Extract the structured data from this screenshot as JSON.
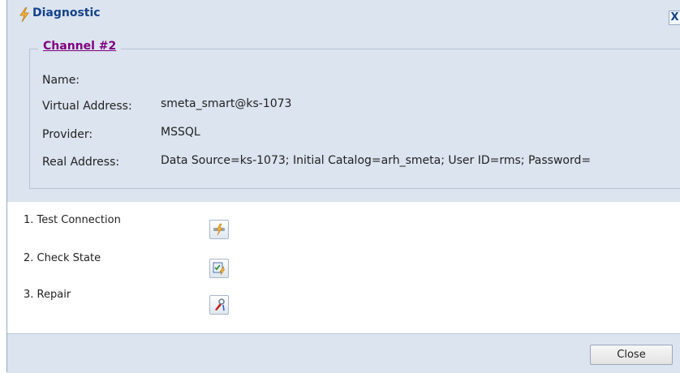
{
  "window": {
    "title": "Diagnostic",
    "close_glyph": "X"
  },
  "channel": {
    "legend": "Channel #2",
    "fields": [
      {
        "label": "Name:",
        "value": ""
      },
      {
        "label": "Virtual Address:",
        "value": "smeta_smart@ks-1073"
      },
      {
        "label": "Provider:",
        "value": "MSSQL"
      },
      {
        "label": "Real Address:",
        "value": "Data Source=ks-1073; Initial Catalog=arh_smeta; User ID=rms; Password="
      }
    ]
  },
  "steps": [
    {
      "label": "1. Test Connection",
      "icon": "plug-icon"
    },
    {
      "label": "2. Check State",
      "icon": "checklist-icon"
    },
    {
      "label": "3. Repair",
      "icon": "wrench-icon"
    }
  ],
  "footer": {
    "close_label": "Close"
  },
  "colors": {
    "title": "#15428b",
    "legend_link": "#800080",
    "window_bg": "#dbe4ef"
  }
}
